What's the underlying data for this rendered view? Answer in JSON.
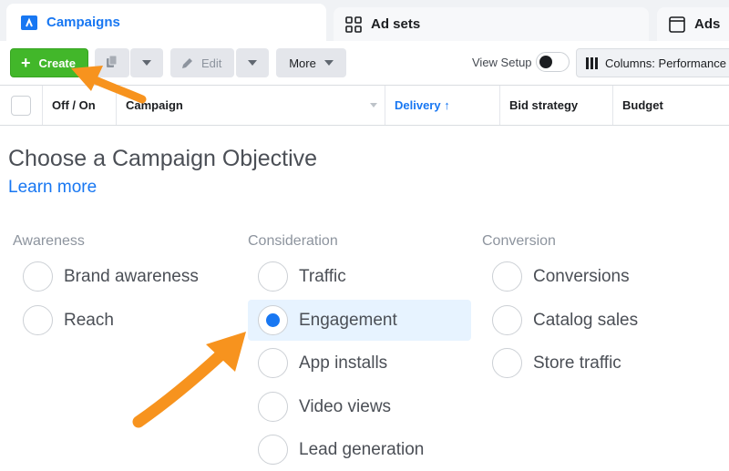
{
  "tabs": [
    {
      "label": "Campaigns",
      "icon": "campaign-flag-icon",
      "active": true
    },
    {
      "label": "Ad sets",
      "icon": "grid-icon",
      "active": false
    },
    {
      "label": "Ads",
      "icon": "window-icon",
      "active": false
    }
  ],
  "toolbar": {
    "create_label": "Create",
    "edit_label": "Edit",
    "more_label": "More",
    "view_setup_label": "View Setup",
    "columns_label": "Columns: Performance"
  },
  "table": {
    "headers": [
      "Off / On",
      "Campaign",
      "Delivery ↑",
      "Bid strategy",
      "Budget"
    ]
  },
  "objective": {
    "title": "Choose a Campaign Objective",
    "learn_more": "Learn more",
    "columns": [
      {
        "heading": "Awareness",
        "options": [
          "Brand awareness",
          "Reach"
        ]
      },
      {
        "heading": "Consideration",
        "options": [
          "Traffic",
          "Engagement",
          "App installs",
          "Video views",
          "Lead generation"
        ]
      },
      {
        "heading": "Conversion",
        "options": [
          "Conversions",
          "Catalog sales",
          "Store traffic"
        ]
      }
    ],
    "selected": "Engagement"
  },
  "colors": {
    "accent": "#1877f2",
    "create_green": "#42b72a",
    "annotation_arrow": "#f7931e"
  }
}
